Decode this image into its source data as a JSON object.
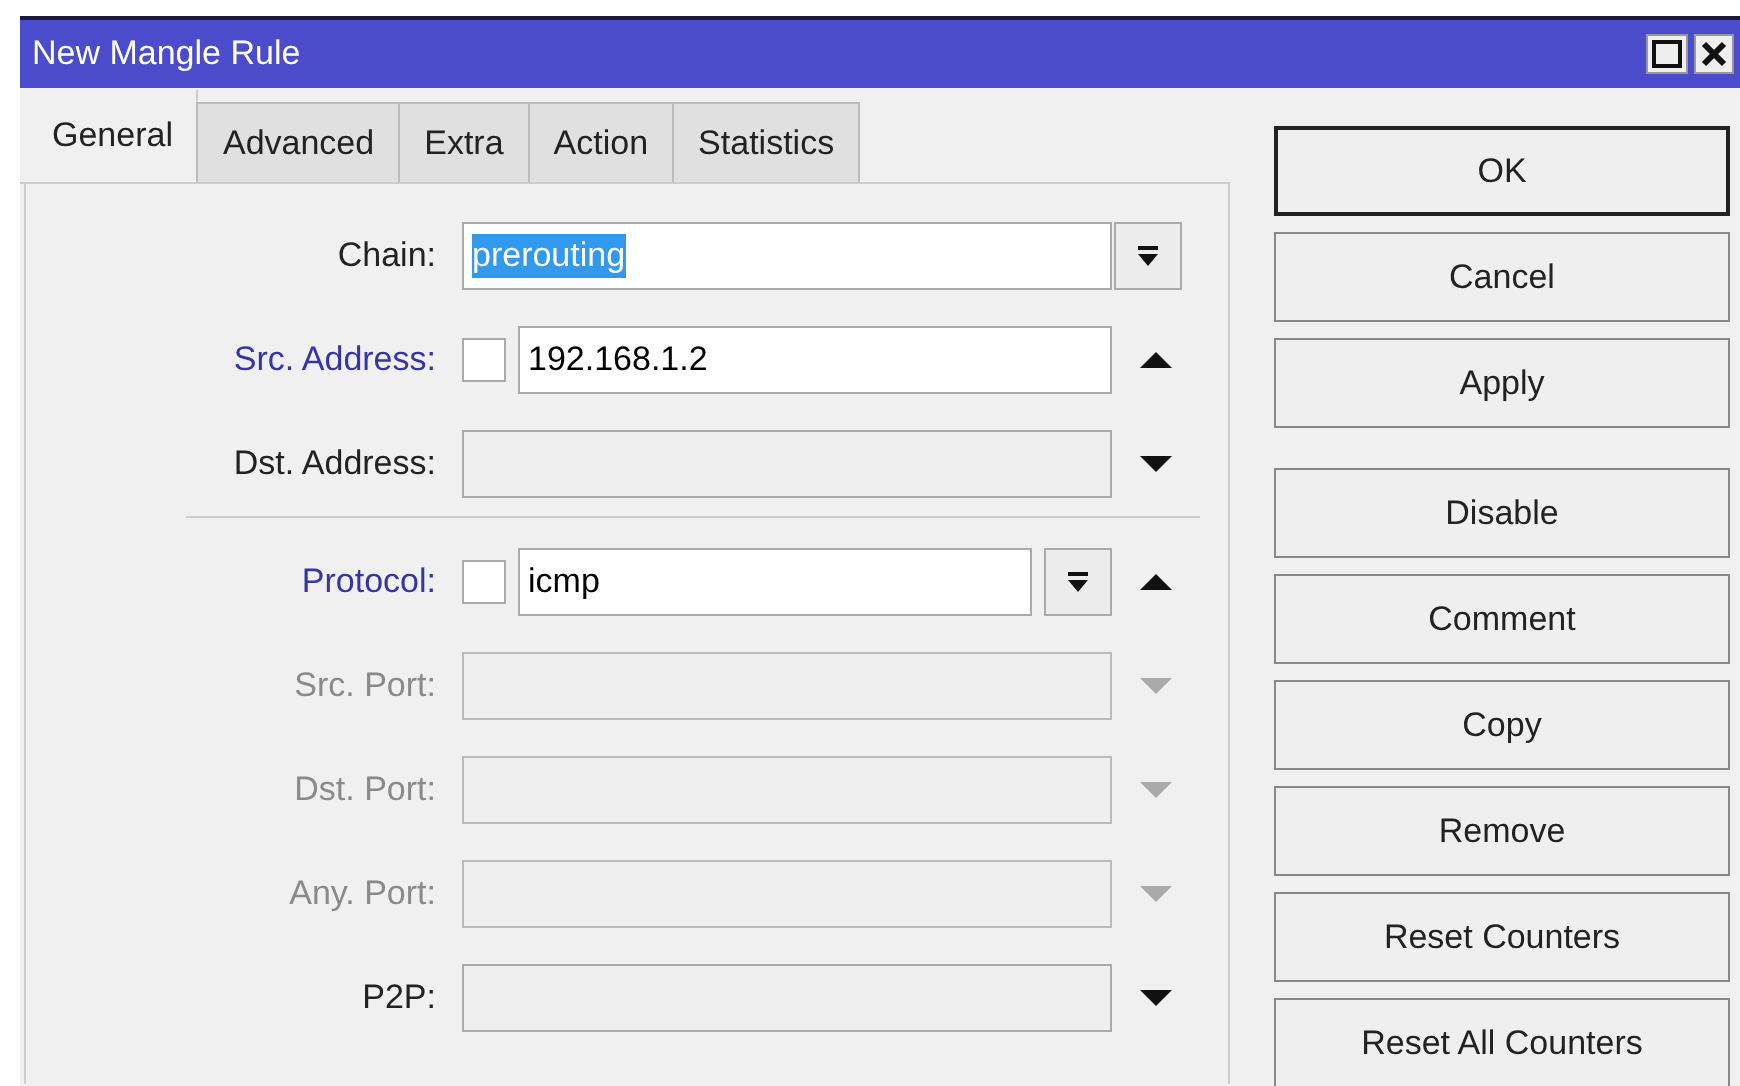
{
  "window": {
    "title": "New Mangle Rule"
  },
  "tabs": [
    {
      "label": "General",
      "selected": true
    },
    {
      "label": "Advanced",
      "selected": false
    },
    {
      "label": "Extra",
      "selected": false
    },
    {
      "label": "Action",
      "selected": false
    },
    {
      "label": "Statistics",
      "selected": false
    }
  ],
  "field_groups": [
    [
      {
        "label": "Chain:",
        "value": "prerouting",
        "value_selected": true,
        "label_active": false,
        "disabled": false,
        "dropdown": true,
        "up_arrow": false,
        "down_arrow": false
      },
      {
        "label": "Src. Address:",
        "value": "192.168.1.2",
        "value_selected": false,
        "label_active": true,
        "disabled": false,
        "dropdown": false,
        "up_arrow": true,
        "down_arrow": false,
        "negate": {
          "checked": false
        }
      },
      {
        "label": "Dst. Address:",
        "label_active": false,
        "disabled": false,
        "dropdown": false,
        "up_arrow": false,
        "down_arrow": true
      }
    ],
    [
      {
        "label": "Protocol:",
        "value": "icmp",
        "value_selected": false,
        "label_active": true,
        "disabled": false,
        "dropdown": true,
        "up_arrow": true,
        "down_arrow": false,
        "negate": {
          "checked": false
        }
      },
      {
        "label": "Src. Port:",
        "disabled": true,
        "dropdown": false,
        "up_arrow": false,
        "down_arrow": true
      },
      {
        "label": "Dst. Port:",
        "disabled": true,
        "dropdown": false,
        "up_arrow": false,
        "down_arrow": true
      },
      {
        "label": "Any. Port:",
        "disabled": true,
        "dropdown": false,
        "up_arrow": false,
        "down_arrow": true
      },
      {
        "label": "P2P:",
        "label_active": false,
        "disabled": false,
        "dropdown": false,
        "up_arrow": false,
        "down_arrow": true
      }
    ]
  ],
  "button_groups": [
    [
      {
        "label": "OK",
        "default": true
      },
      {
        "label": "Cancel",
        "default": false
      },
      {
        "label": "Apply",
        "default": false
      }
    ],
    [
      {
        "label": "Disable",
        "default": false
      },
      {
        "label": "Comment",
        "default": false
      },
      {
        "label": "Copy",
        "default": false
      },
      {
        "label": "Remove",
        "default": false
      },
      {
        "label": "Reset Counters",
        "default": false
      },
      {
        "label": "Reset All Counters",
        "default": false
      }
    ]
  ]
}
